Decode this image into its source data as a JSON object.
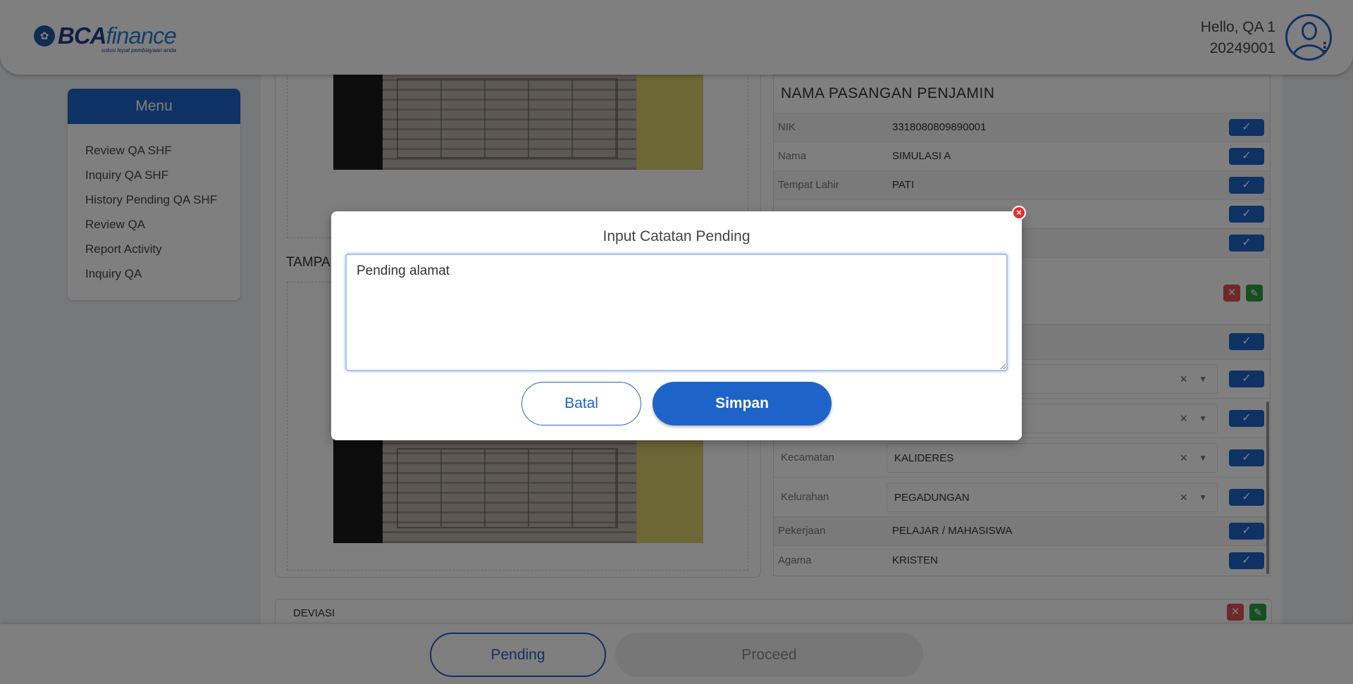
{
  "header": {
    "logo_bca": "BCA",
    "logo_finance": "finance",
    "logo_tagline": "solusi tepat pembiayaan anda",
    "greeting": "Hello, QA 1",
    "user_id": "20249001",
    "avatar_icon": "user-avatar-icon",
    "menu_icon": "kebab-menu-icon"
  },
  "sidebar": {
    "title": "Menu",
    "items": [
      {
        "label": "Review QA SHF"
      },
      {
        "label": "Inquiry QA SHF"
      },
      {
        "label": "History Pending QA SHF"
      },
      {
        "label": "Review QA"
      },
      {
        "label": "Report Activity"
      },
      {
        "label": "Inquiry QA"
      }
    ]
  },
  "main": {
    "tampak_label": "TAMPA",
    "detail_title": "NAMA PASANGAN PENJAMIN",
    "rows": [
      {
        "label": "NIK",
        "value": "3318080809890001"
      },
      {
        "label": "Nama",
        "value": "SIMULASI A"
      },
      {
        "label": "Tempat Lahir",
        "value": "PATI"
      },
      {
        "label": "Kecamatan",
        "value": "KALIDERES"
      },
      {
        "label": "Kelurahan",
        "value": "PEGADUNGAN"
      },
      {
        "label": "Pekerjaan",
        "value": "PELAJAR / MAHASISWA"
      },
      {
        "label": "Agama",
        "value": "KRISTEN"
      }
    ],
    "check_icon": "✓",
    "deviasi_label": "DEVIASI"
  },
  "footer": {
    "pending_label": "Pending",
    "proceed_label": "Proceed"
  },
  "modal": {
    "title": "Input Catatan Pending",
    "note_value": "Pending alamat",
    "cancel_label": "Batal",
    "save_label": "Simpan",
    "close_icon": "×"
  },
  "colors": {
    "primary": "#1e64c8",
    "close_red": "#e53030",
    "edit_green": "#2e9e48"
  }
}
